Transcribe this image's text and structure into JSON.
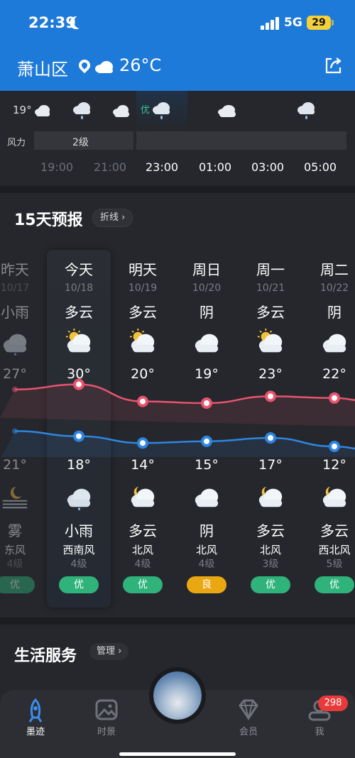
{
  "status": {
    "time": "22:39",
    "network": "5G",
    "battery": "29"
  },
  "header": {
    "city": "萧山区",
    "temp": "26°C"
  },
  "hourly": {
    "temp_label": "19°",
    "aqi": "优",
    "wind_label": "风力",
    "wind_value": "2级",
    "times": [
      "19:00",
      "21:00",
      "23:00",
      "01:00",
      "03:00",
      "05:00"
    ]
  },
  "forecast": {
    "title": "15天预报",
    "mode": "折线 ›",
    "days": [
      {
        "name": "昨天",
        "date": "10/17",
        "day_wx": "小雨",
        "high": "27°",
        "low": "21°",
        "night_wx": "雾",
        "wind": "东风",
        "level": "4级",
        "aqi": "优",
        "aqi_color": "#2fb37a"
      },
      {
        "name": "今天",
        "date": "10/18",
        "day_wx": "多云",
        "high": "30°",
        "low": "18°",
        "night_wx": "小雨",
        "wind": "西南风",
        "level": "4级",
        "aqi": "优",
        "aqi_color": "#2fb37a"
      },
      {
        "name": "明天",
        "date": "10/19",
        "day_wx": "多云",
        "high": "20°",
        "low": "14°",
        "night_wx": "多云",
        "wind": "北风",
        "level": "4级",
        "aqi": "优",
        "aqi_color": "#2fb37a"
      },
      {
        "name": "周日",
        "date": "10/20",
        "day_wx": "阴",
        "high": "19°",
        "low": "15°",
        "night_wx": "阴",
        "wind": "北风",
        "level": "4级",
        "aqi": "良",
        "aqi_color": "#e9a712"
      },
      {
        "name": "周一",
        "date": "10/21",
        "day_wx": "多云",
        "high": "23°",
        "low": "17°",
        "night_wx": "多云",
        "wind": "北风",
        "level": "3级",
        "aqi": "优",
        "aqi_color": "#2fb37a"
      },
      {
        "name": "周二",
        "date": "10/22",
        "day_wx": "阴",
        "high": "22°",
        "low": "12°",
        "night_wx": "多云",
        "wind": "西北风",
        "level": "5级",
        "aqi": "优",
        "aqi_color": "#2fb37a"
      }
    ],
    "chart_data": {
      "type": "line",
      "categories": [
        "10/17",
        "10/18",
        "10/19",
        "10/20",
        "10/21",
        "10/22"
      ],
      "series": [
        {
          "values": [
            27,
            30,
            20,
            19,
            23,
            22
          ],
          "color": "#e8546e"
        },
        {
          "values": [
            21,
            18,
            14,
            15,
            17,
            12
          ],
          "color": "#2f86e0"
        }
      ]
    }
  },
  "life": {
    "title": "生活服务",
    "manage": "管理 ›"
  },
  "nav": {
    "items": [
      {
        "label": "墨迹"
      },
      {
        "label": "时景"
      },
      {
        "label": "会员"
      },
      {
        "label": "我"
      }
    ],
    "badge": "298"
  },
  "colors": {
    "header_bg": "#1e7ad8",
    "accent_green": "#2fb37a",
    "accent_amber": "#e9a712"
  }
}
